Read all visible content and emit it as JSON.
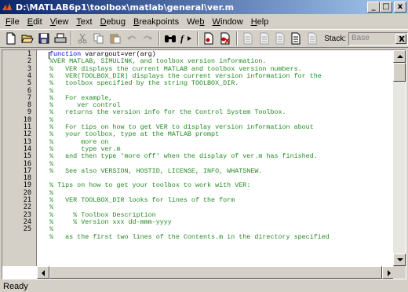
{
  "window": {
    "title": "D:\\MATLAB6p1\\toolbox\\matlab\\general\\ver.m",
    "minimize": "_",
    "maximize": "□",
    "close": "x"
  },
  "menu": [
    {
      "ul": "F",
      "rest": "ile"
    },
    {
      "ul": "E",
      "rest": "dit"
    },
    {
      "ul": "V",
      "rest": "iew"
    },
    {
      "ul": "T",
      "rest": "ext"
    },
    {
      "ul": "D",
      "rest": "ebug"
    },
    {
      "ul": "B",
      "rest": "reakpoints"
    },
    {
      "pre": "We",
      "ul": "b",
      "rest": ""
    },
    {
      "ul": "W",
      "rest": "indow"
    },
    {
      "ul": "H",
      "rest": "elp"
    }
  ],
  "toolbar": {
    "stack_label": "Stack:",
    "stack_value": "Base",
    "close_glyph": "x",
    "icons": [
      "new-file-icon",
      "open-folder-icon",
      "save-icon",
      "print-icon",
      "cut-icon",
      "copy-icon",
      "paste-icon",
      "undo-icon",
      "redo-icon",
      "find-icon",
      "function-icon",
      "set-breakpoint-icon",
      "clear-breakpoints-icon",
      "step-icon",
      "step-in-icon",
      "step-out-icon",
      "continue-icon",
      "exit-debug-icon"
    ]
  },
  "editor": {
    "line_numbers": [
      "1",
      "2",
      "3",
      "4",
      "5",
      "6",
      "7",
      "8",
      "9",
      "10",
      "11",
      "12",
      "13",
      "14",
      "15",
      "16",
      "17",
      "18",
      "19",
      "20",
      "21",
      "22",
      "23",
      "24",
      "25"
    ],
    "lines": [
      {
        "kw": "function",
        "text": " varargout=ver(arg)"
      },
      {
        "text": "%VER MATLAB, SIMULINK, and toolbox version information."
      },
      {
        "text": "%   VER displays the current MATLAB and toolbox version numbers."
      },
      {
        "text": "%   VER(TOOLBOX_DIR) displays the current version information for the"
      },
      {
        "text": "%   toolbox specified by the string TOOLBOX_DIR."
      },
      {
        "text": "%"
      },
      {
        "text": "%   For example,"
      },
      {
        "text": "%      ver control"
      },
      {
        "text": "%   returns the version info for the Control System Toolbox."
      },
      {
        "text": "%"
      },
      {
        "text": "%   For tips on how to get VER to display version information about"
      },
      {
        "text": "%   your toolbox, type at the MATLAB prompt"
      },
      {
        "text": "%       more on"
      },
      {
        "text": "%       type ver.m"
      },
      {
        "text": "%   and then type 'more off' when the display of ver.m has finished."
      },
      {
        "text": "%"
      },
      {
        "text": "%   See also VERSION, HOSTID, LICENSE, INFO, WHATSNEW."
      },
      {
        "text": ""
      },
      {
        "text": "% Tips on how to get your toolbox to work with VER:"
      },
      {
        "text": "%"
      },
      {
        "text": "%   VER TOOLBOX_DIR looks for lines of the form"
      },
      {
        "text": "%"
      },
      {
        "text": "%     % Toolbox Description"
      },
      {
        "text": "%     % Version xxx dd-mmm-yyyy"
      },
      {
        "text": "%"
      },
      {
        "text": "%   as the first two lines of the Contents.m in the directory specified"
      }
    ]
  },
  "status": {
    "text": "Ready"
  }
}
